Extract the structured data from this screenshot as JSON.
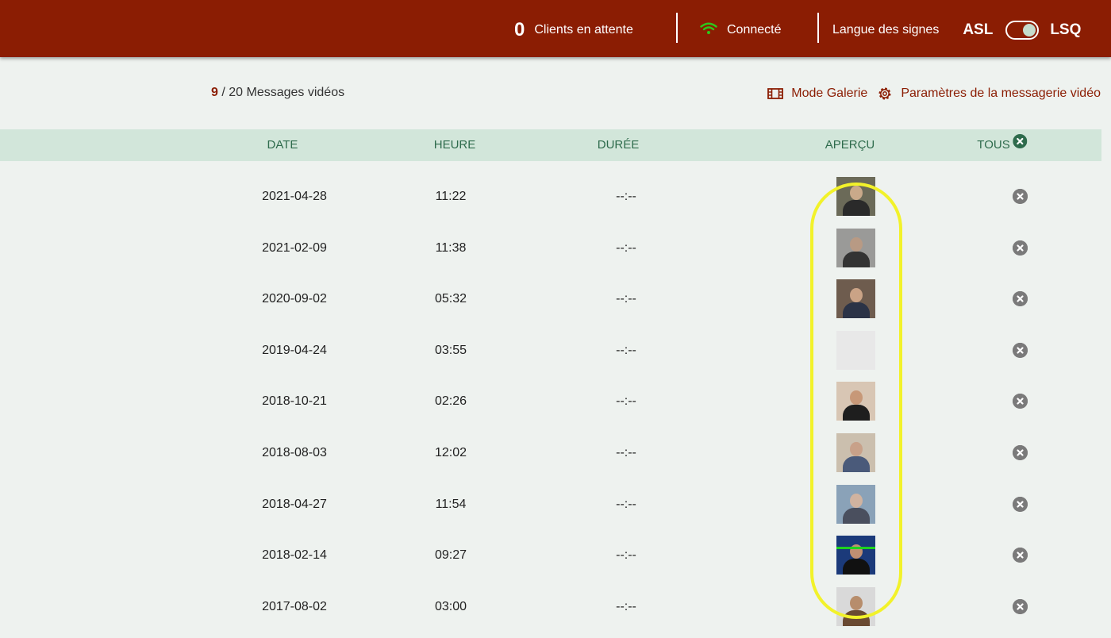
{
  "header": {
    "waiting_count": "0",
    "waiting_label": "Clients en attente",
    "status_label": "Connecté",
    "language_label": "Langue des signes",
    "lang_left": "ASL",
    "lang_right": "LSQ",
    "accent_color": "#8b1d03",
    "status_color": "#2ec71b"
  },
  "summary": {
    "current": "9",
    "total_text": " / 20 Messages vidéos"
  },
  "actions": {
    "gallery_label": "Mode Galerie",
    "settings_label": "Paramètres de la messagerie vidéo"
  },
  "table": {
    "columns": {
      "date": "DATE",
      "time": "HEURE",
      "duration": "DURÉE",
      "preview": "APERÇU",
      "all": "TOUS"
    },
    "rows": [
      {
        "date": "2021-04-28",
        "time": "11:22",
        "duration": "--:--",
        "preview": {
          "bg": "#6b6a58",
          "skin": "#c9a98a",
          "shirt": "#2a2a2a"
        }
      },
      {
        "date": "2021-02-09",
        "time": "11:38",
        "duration": "--:--",
        "preview": {
          "bg": "#9a9a98",
          "skin": "#b89a84",
          "shirt": "#333333"
        }
      },
      {
        "date": "2020-09-02",
        "time": "05:32",
        "duration": "--:--",
        "preview": {
          "bg": "#6e5c4e",
          "skin": "#caa386",
          "shirt": "#2b3346"
        }
      },
      {
        "date": "2019-04-24",
        "time": "03:55",
        "duration": "--:--",
        "preview": null
      },
      {
        "date": "2018-10-21",
        "time": "02:26",
        "duration": "--:--",
        "preview": {
          "bg": "#d8c6b4",
          "skin": "#c79878",
          "shirt": "#1e1e1e"
        }
      },
      {
        "date": "2018-08-03",
        "time": "12:02",
        "duration": "--:--",
        "preview": {
          "bg": "#cbbfae",
          "skin": "#c8a189",
          "shirt": "#4a5a7a"
        }
      },
      {
        "date": "2018-04-27",
        "time": "11:54",
        "duration": "--:--",
        "preview": {
          "bg": "#8aa2b8",
          "skin": "#d0b3a0",
          "shirt": "#4a4f5e"
        }
      },
      {
        "date": "2018-02-14",
        "time": "09:27",
        "duration": "--:--",
        "preview": {
          "bg": "#1b3a7a",
          "skin": "#c08f72",
          "shirt": "#111111",
          "line": "#1ed21e"
        }
      },
      {
        "date": "2017-08-02",
        "time": "03:00",
        "duration": "--:--",
        "preview": {
          "bg": "#d9d9d9",
          "skin": "#b78d6c",
          "shirt": "#6a4a32"
        }
      }
    ]
  }
}
